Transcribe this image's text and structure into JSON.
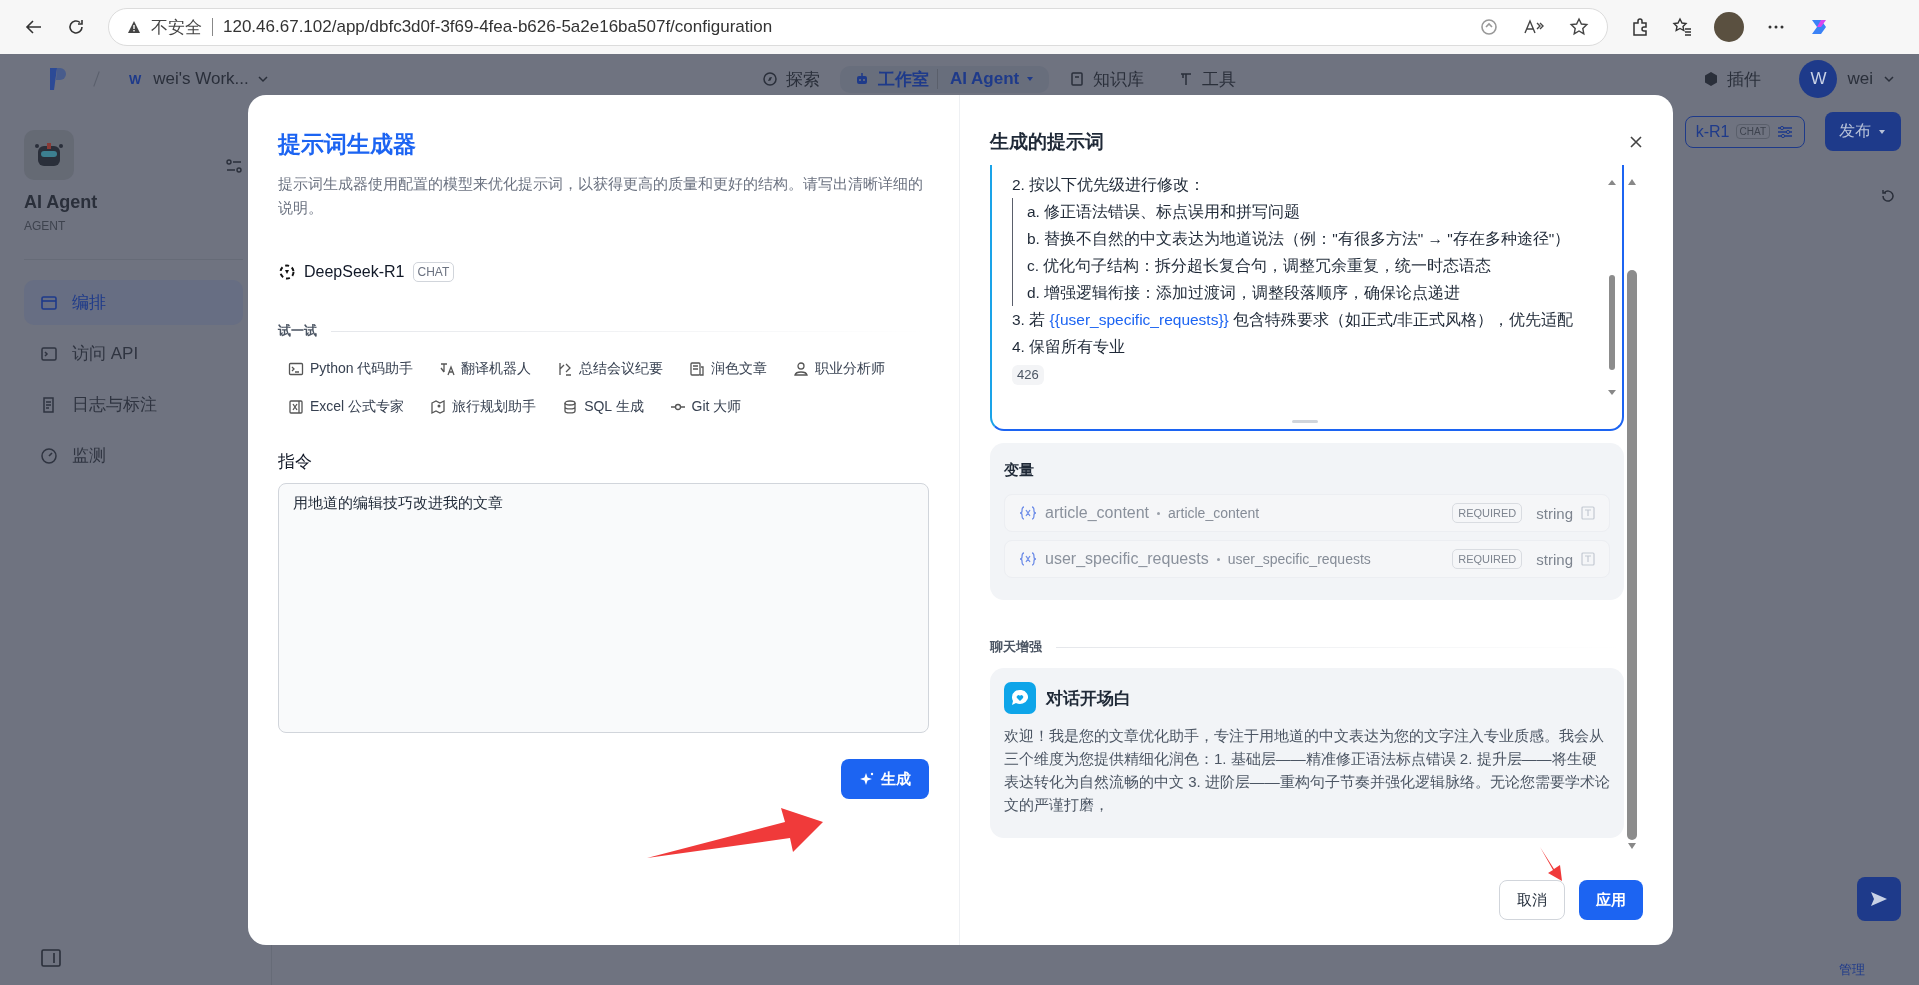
{
  "browser": {
    "security": "不安全",
    "url": "120.46.67.102/app/dbfc3d0f-3f69-4fea-b626-5a2e16ba507f/configuration"
  },
  "nav": {
    "workspace_initial": "W",
    "workspace": "wei's Work...",
    "tabs": [
      {
        "label": "探索",
        "selected": false
      },
      {
        "label": "工作室",
        "sub": "AI Agent",
        "selected": true
      },
      {
        "label": "知识库",
        "selected": false
      },
      {
        "label": "工具",
        "selected": false
      }
    ],
    "plugins": "插件",
    "user_initial": "W",
    "user": "wei"
  },
  "sidebar": {
    "app_name": "AI Agent",
    "app_type": "AGENT",
    "items": [
      {
        "label": "编排",
        "selected": true
      },
      {
        "label": "访问 API",
        "selected": false
      },
      {
        "label": "日志与标注",
        "selected": false
      },
      {
        "label": "监测",
        "selected": false
      }
    ]
  },
  "main": {
    "model_name": "k-R1",
    "model_badge": "CHAT",
    "publish": "发布",
    "manage": "管理"
  },
  "modal": {
    "left": {
      "title": "提示词生成器",
      "description": "提示词生成器使用配置的模型来优化提示词，以获得更高的质量和更好的结构。请写出清晰详细的说明。",
      "model": {
        "name": "DeepSeek-R1",
        "badge": "CHAT"
      },
      "try_label": "试一试",
      "presets": [
        {
          "label": "Python 代码助手"
        },
        {
          "label": "翻译机器人"
        },
        {
          "label": "总结会议纪要"
        },
        {
          "label": "润色文章"
        },
        {
          "label": "职业分析师"
        },
        {
          "label": "Excel 公式专家"
        },
        {
          "label": "旅行规划助手"
        },
        {
          "label": "SQL 生成"
        },
        {
          "label": "Git 大师"
        }
      ],
      "instruction_label": "指令",
      "instruction_value": "用地道的编辑技巧改进我的文章",
      "generate": "生成"
    },
    "right": {
      "title": "生成的提示词",
      "prompt": [
        {
          "parts": [
            {
              "text": "2. 按以下优先级进行修改："
            }
          ],
          "children": [
            {
              "parts": [
                {
                  "text": "a. 修正语法错误、标点误用和拼写问题"
                }
              ]
            },
            {
              "parts": [
                {
                  "text": "b. 替换不自然的中文表达为地道说法（例：\"有很多方法\" → \"存在多种途径\"）"
                }
              ]
            },
            {
              "parts": [
                {
                  "text": "c. 优化句子结构：拆分超长复合句，调整冗余重复，统一时态语态"
                }
              ]
            },
            {
              "parts": [
                {
                  "text": "d. 增强逻辑衔接：添加过渡词，调整段落顺序，确保论点递进"
                }
              ]
            }
          ]
        },
        {
          "parts": [
            {
              "text": "3. 若 "
            },
            {
              "text": "{{user_specific_requests}}",
              "kind": "variable"
            },
            {
              "text": " 包含特殊要求（如正式/非正式风格），优先适配"
            }
          ]
        },
        {
          "parts": [
            {
              "text": "4. 保留所有专业"
            }
          ]
        }
      ],
      "char_count": "426",
      "variables_title": "变量",
      "variables": [
        {
          "name": "article_content",
          "label": "article_content",
          "required": "REQUIRED",
          "type": "string"
        },
        {
          "name": "user_specific_requests",
          "label": "user_specific_requests",
          "required": "REQUIRED",
          "type": "string"
        }
      ],
      "chat_section": "聊天增强",
      "opener": {
        "title": "对话开场白",
        "text": "欢迎！我是您的文章优化助手，专注于用地道的中文表达为您的文字注入专业质感。我会从三个维度为您提供精细化润色：1. 基础层——精准修正语法标点错误 2. 提升层——将生硬表达转化为自然流畅的中文 3. 进阶层——重构句子节奏并强化逻辑脉络。无论您需要学术论文的严谨打磨，"
      },
      "cancel": "取消",
      "apply": "应用"
    }
  }
}
